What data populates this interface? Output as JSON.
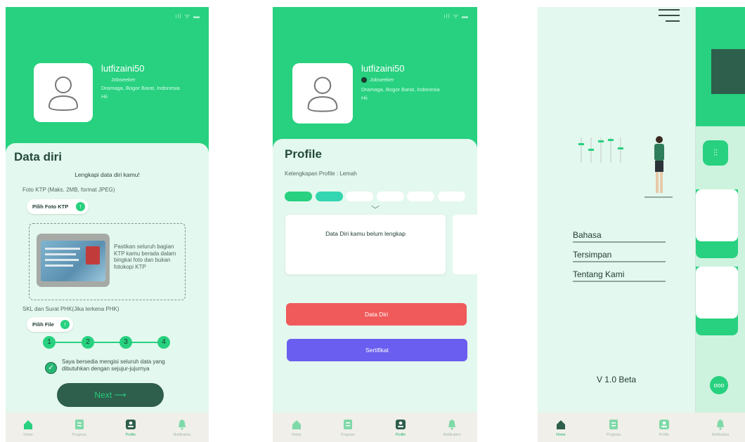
{
  "status_icons": "ıll ᯤ ▬",
  "screen1": {
    "username": "lutfizaini50",
    "role": "Jobseeker",
    "location": "Dramaga, Bogor Barat, Indonesia",
    "greeting": "Hii",
    "title": "Data diri",
    "subtitle": "Lengkapi data diri kamu!",
    "ktp_label": "Foto KTP (Maks. 2MB, format JPEG)",
    "ktp_button": "Pilih Foto KTP",
    "ktp_hint": "Pastikan seluruh bagian KTP kamu berada dalam bingkai foto dan bukan fotokopi KTP",
    "skl_label": "SKL dan Surat PHK(Jika terkena PHK)",
    "file_button": "Pilih File",
    "steps": [
      "1",
      "2",
      "3",
      "4"
    ],
    "agreement": "Saya bersedia mengisi seluruh data yang dibutuhkan dengan sejujur-jujurnya",
    "next_button": "Next"
  },
  "screen2": {
    "username": "lutfizaini50",
    "role": "Jobseeker",
    "location": "Dramaga, Bogor Barat, Indonesia",
    "greeting": "Hii",
    "title": "Profile",
    "completeness": "Kelengkapan Profile : Lemah",
    "completeness_filled": 2,
    "completeness_total": 6,
    "card_text": "Data Diri kamu belum lengkap",
    "button_data_diri": "Data Diri",
    "button_sertifikat": "Sertifikat",
    "colors": {
      "data_diri": "#f05a5a",
      "sertifikat": "#6a5ef0"
    }
  },
  "screen3": {
    "menu": [
      "Bahasa",
      "Tersimpan",
      "Tentang Kami"
    ],
    "version": "V 1.0 Beta"
  },
  "nav": {
    "items": [
      "Home",
      "Progress",
      "Profile",
      "Notification"
    ]
  },
  "colors": {
    "accent": "#27d17f",
    "sheet": "#e3f8ee",
    "dark_green": "#2e5e4c"
  }
}
